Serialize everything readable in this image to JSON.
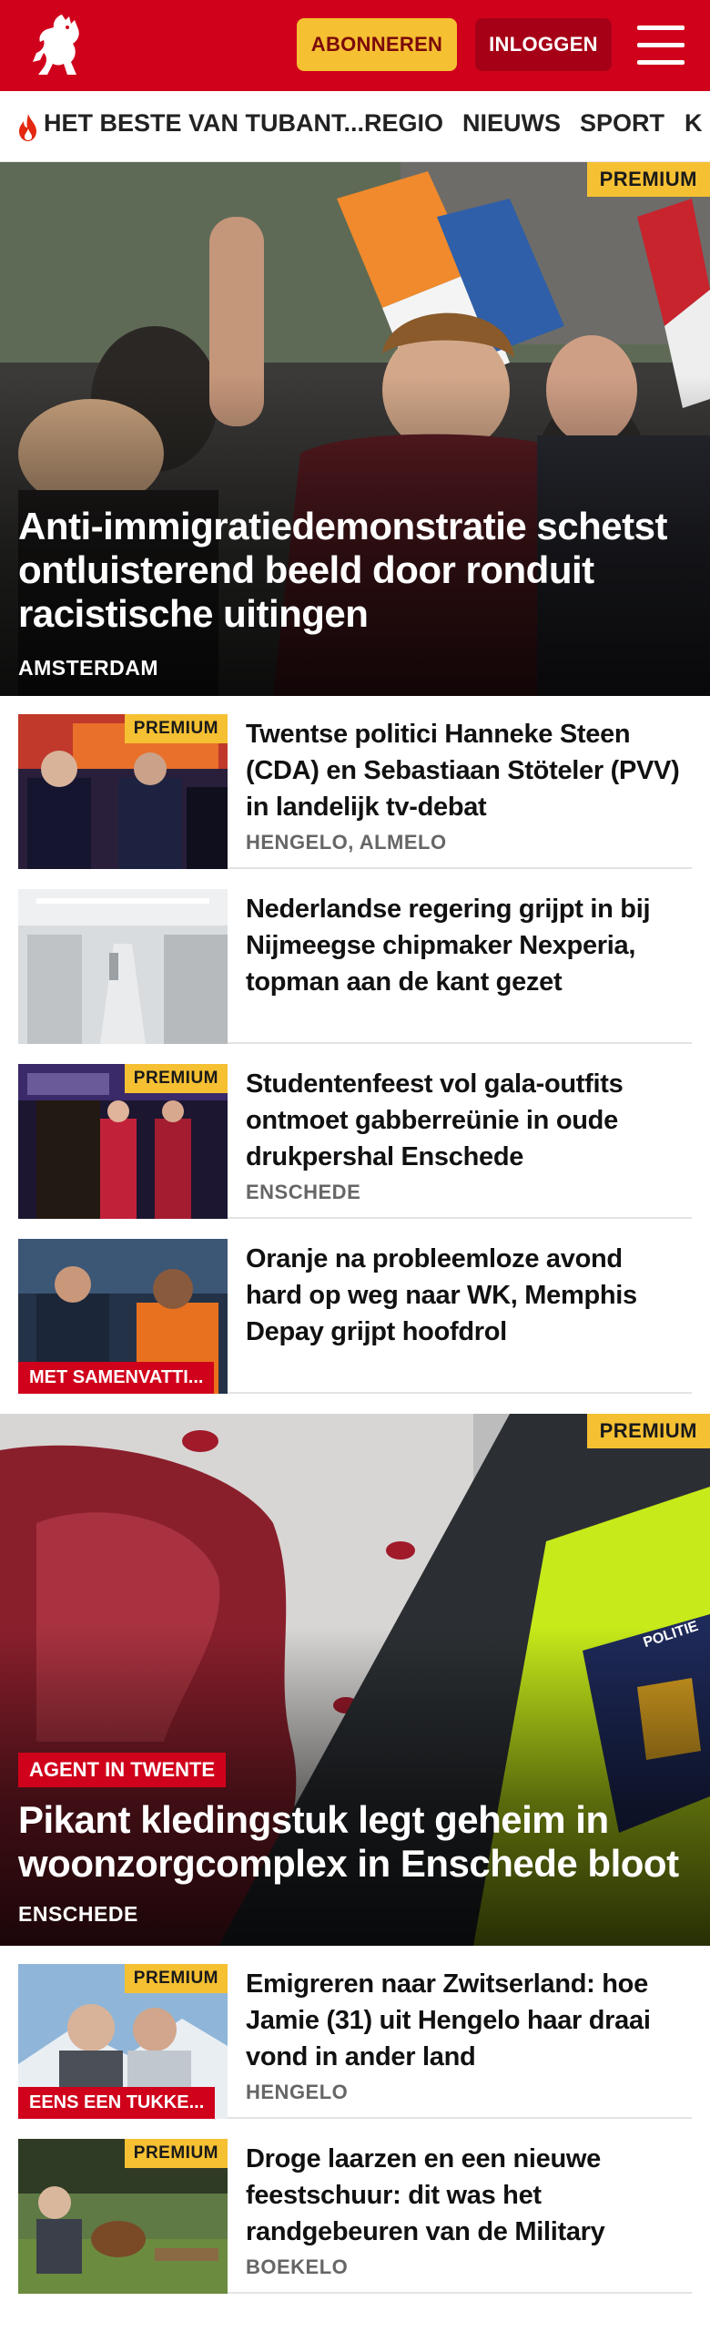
{
  "header": {
    "subscribe_label": "ABONNEREN",
    "login_label": "INLOGGEN",
    "brand_color": "#d0021b",
    "accent_color": "#f5c032"
  },
  "nav": {
    "items": [
      "HET BESTE VAN TUBANT...",
      "REGIO",
      "NIEUWS",
      "SPORT",
      "K"
    ]
  },
  "hero1": {
    "badge": "PREMIUM",
    "title": "Anti-immigratiedemonstratie schetst ontluisterend beeld door ronduit racistische uitingen",
    "location": "AMSTERDAM"
  },
  "list1": [
    {
      "title": "Twentse politici Hanneke Steen (CDA) en Sebastiaan Stöteler (PVV) in landelijk tv-debat",
      "meta": "HENGELO, ALMELO",
      "badge": "PREMIUM",
      "label": ""
    },
    {
      "title": "Nederlandse regering grijpt in bij Nijmeegse chipmaker Nexperia, topman aan de kant gezet",
      "meta": "",
      "badge": "",
      "label": ""
    },
    {
      "title": "Studentenfeest vol gala-outfits ontmoet gabberreünie in oude drukpershal Enschede",
      "meta": "ENSCHEDE",
      "badge": "PREMIUM",
      "label": ""
    },
    {
      "title": "Oranje na probleemloze avond hard op weg naar WK, Memphis Depay grijpt hoofdrol",
      "meta": "",
      "badge": "",
      "label": "MET SAMENVATTI..."
    }
  ],
  "hero2": {
    "badge": "PREMIUM",
    "label": "AGENT IN TWENTE",
    "title": "Pikant kledingstuk legt geheim in woonzorgcomplex in Enschede bloot",
    "location": "ENSCHEDE",
    "police_text": "POLITIE"
  },
  "list2": [
    {
      "title": "Emigreren naar Zwitserland: hoe Jamie (31) uit Hengelo haar draai vond in ander land",
      "meta": "HENGELO",
      "badge": "PREMIUM",
      "label": "EENS EEN TUKKE..."
    },
    {
      "title": "Droge laarzen en een nieuwe feestschuur: dit was het randgebeuren van de Military",
      "meta": "BOEKELO",
      "badge": "PREMIUM",
      "label": ""
    }
  ]
}
